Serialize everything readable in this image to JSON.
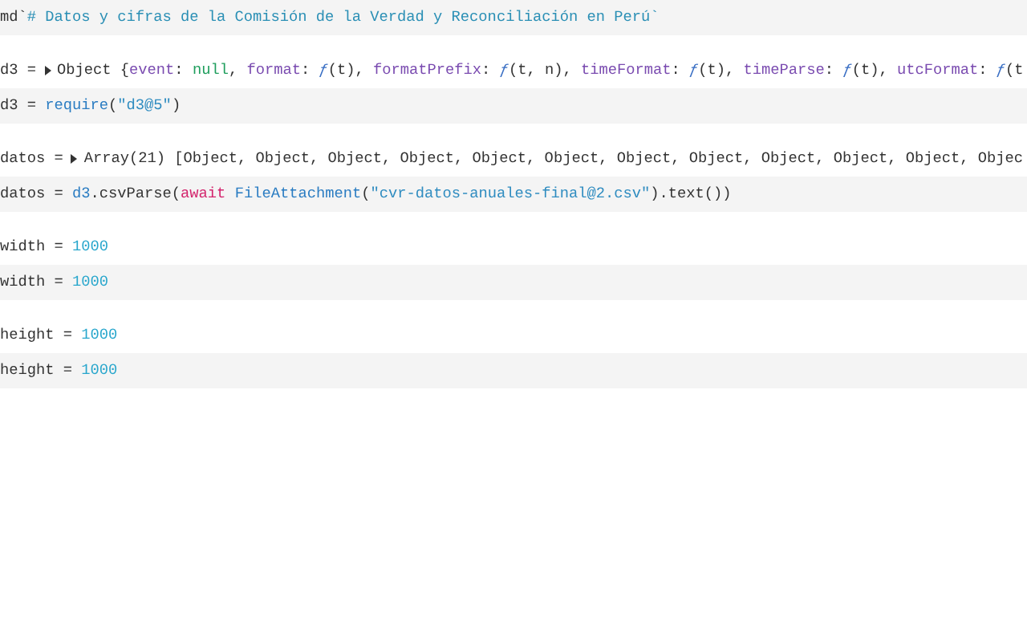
{
  "cells": [
    {
      "source": [
        {
          "kind": "tag",
          "text": "md`"
        },
        {
          "kind": "markdown",
          "text": "# Datos y cifras de la Comisión de la Verdad y Reconciliación en Perú`"
        }
      ]
    },
    {
      "output": [
        {
          "kind": "plain",
          "text": "d3 ="
        },
        {
          "kind": "toggle",
          "expanded": false
        },
        {
          "kind": "plain",
          "text": "Object {"
        },
        {
          "kind": "prop",
          "text": "event"
        },
        {
          "kind": "plain",
          "text": ": "
        },
        {
          "kind": "null",
          "text": "null"
        },
        {
          "kind": "plain",
          "text": ", "
        },
        {
          "kind": "prop",
          "text": "format"
        },
        {
          "kind": "plain",
          "text": ": "
        },
        {
          "kind": "func",
          "text": "ƒ"
        },
        {
          "kind": "plain",
          "text": "(t), "
        },
        {
          "kind": "prop",
          "text": "formatPrefix"
        },
        {
          "kind": "plain",
          "text": ": "
        },
        {
          "kind": "func",
          "text": "ƒ"
        },
        {
          "kind": "plain",
          "text": "(t, n), "
        },
        {
          "kind": "prop",
          "text": "timeFormat"
        },
        {
          "kind": "plain",
          "text": ": "
        },
        {
          "kind": "func",
          "text": "ƒ"
        },
        {
          "kind": "plain",
          "text": "(t), "
        },
        {
          "kind": "prop",
          "text": "timeParse"
        },
        {
          "kind": "plain",
          "text": ": "
        },
        {
          "kind": "func",
          "text": "ƒ"
        },
        {
          "kind": "plain",
          "text": "(t), "
        },
        {
          "kind": "prop",
          "text": "utcFormat"
        },
        {
          "kind": "plain",
          "text": ": "
        },
        {
          "kind": "func",
          "text": "ƒ"
        },
        {
          "kind": "plain",
          "text": "(t"
        }
      ],
      "source": [
        {
          "kind": "plain",
          "text": "d3 = "
        },
        {
          "kind": "ident",
          "text": "require"
        },
        {
          "kind": "plain",
          "text": "("
        },
        {
          "kind": "string",
          "text": "\"d3@5\""
        },
        {
          "kind": "plain",
          "text": ")"
        }
      ]
    },
    {
      "output": [
        {
          "kind": "plain",
          "text": "datos ="
        },
        {
          "kind": "toggle",
          "expanded": false
        },
        {
          "kind": "plain",
          "text": "Array(21) [Object, Object, Object, Object, Object, Object, Object, Object, Object, Object, Object, Objec"
        }
      ],
      "source": [
        {
          "kind": "plain",
          "text": "datos = "
        },
        {
          "kind": "ident",
          "text": "d3"
        },
        {
          "kind": "plain",
          "text": ".csvParse("
        },
        {
          "kind": "keyword",
          "text": "await"
        },
        {
          "kind": "ident",
          "text": "FileAttachment"
        },
        {
          "kind": "plain",
          "text": "("
        },
        {
          "kind": "string",
          "text": "\"cvr-datos-anuales-final@2.csv\""
        },
        {
          "kind": "plain",
          "text": ").text())"
        }
      ]
    },
    {
      "output": [
        {
          "kind": "plain",
          "text": "width = "
        },
        {
          "kind": "number",
          "text": "1000"
        }
      ],
      "source": [
        {
          "kind": "plain",
          "text": "width = "
        },
        {
          "kind": "number",
          "text": "1000"
        }
      ]
    },
    {
      "output": [
        {
          "kind": "plain",
          "text": "height = "
        },
        {
          "kind": "number",
          "text": "1000"
        }
      ],
      "source": [
        {
          "kind": "plain",
          "text": "height = "
        },
        {
          "kind": "number",
          "text": "1000"
        }
      ]
    }
  ]
}
